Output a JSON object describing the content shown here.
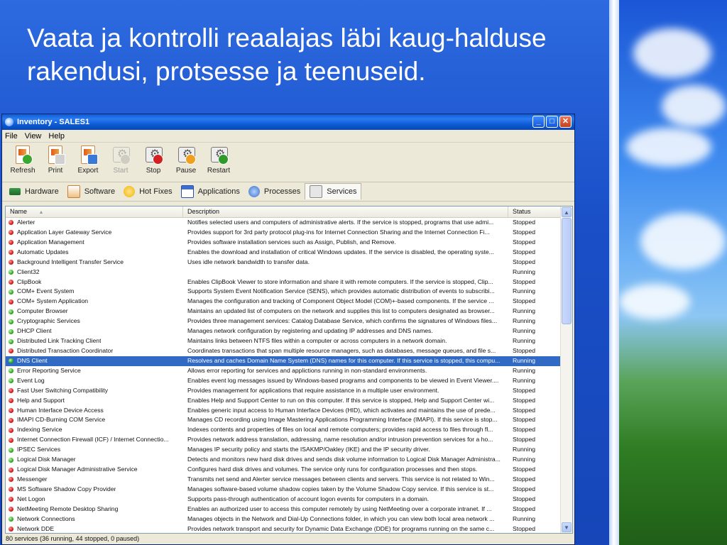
{
  "slide": {
    "title": "Vaata ja kontrolli reaalajas läbi kaug-halduse rakendusi, protsesse ja teenuseid."
  },
  "window": {
    "title": "Inventory - SALES1",
    "controls": {
      "minimize": "_",
      "maximize": "□",
      "close": "✕"
    }
  },
  "menu": {
    "file": "File",
    "view": "View",
    "help": "Help"
  },
  "toolbar": {
    "refresh": "Refresh",
    "print": "Print",
    "export": "Export",
    "start": "Start",
    "stop": "Stop",
    "pause": "Pause",
    "restart": "Restart"
  },
  "tabs": {
    "hardware": "Hardware",
    "software": "Software",
    "hotfixes": "Hot Fixes",
    "applications": "Applications",
    "processes": "Processes",
    "services": "Services"
  },
  "list": {
    "columns": {
      "name": "Name",
      "description": "Description",
      "status": "Status"
    },
    "sort_indicator": "▲",
    "rows": [
      {
        "name": "Alerter",
        "description": "Notifies selected users and computers of administrative alerts. If the service is stopped, programs that use admi...",
        "status": "Stopped",
        "icon": "stopped"
      },
      {
        "name": "Application Layer Gateway Service",
        "description": "Provides support for 3rd party protocol plug-ins for Internet Connection Sharing and the Internet Connection Fi...",
        "status": "Stopped",
        "icon": "stopped"
      },
      {
        "name": "Application Management",
        "description": "Provides software installation services such as Assign, Publish, and Remove.",
        "status": "Stopped",
        "icon": "stopped"
      },
      {
        "name": "Automatic Updates",
        "description": "Enables the download and installation of critical Windows updates. If the service is disabled, the operating syste...",
        "status": "Stopped",
        "icon": "stopped"
      },
      {
        "name": "Background Intelligent Transfer Service",
        "description": "Uses idle network bandwidth to transfer data.",
        "status": "Stopped",
        "icon": "stopped"
      },
      {
        "name": "Client32",
        "description": "",
        "status": "Running",
        "icon": "running"
      },
      {
        "name": "ClipBook",
        "description": "Enables ClipBook Viewer to store information and share it with remote computers. If the service is stopped, Clip...",
        "status": "Stopped",
        "icon": "stopped"
      },
      {
        "name": "COM+ Event System",
        "description": "Supports System Event Notification Service (SENS), which provides automatic distribution of events to subscribi...",
        "status": "Running",
        "icon": "running"
      },
      {
        "name": "COM+ System Application",
        "description": "Manages the configuration and tracking of Component Object Model (COM)+-based components. If the service ...",
        "status": "Stopped",
        "icon": "stopped"
      },
      {
        "name": "Computer Browser",
        "description": "Maintains an updated list of computers on the network and supplies this list to computers designated as browser...",
        "status": "Running",
        "icon": "running"
      },
      {
        "name": "Cryptographic Services",
        "description": "Provides three management services: Catalog Database Service, which confirms the signatures of Windows files...",
        "status": "Running",
        "icon": "running"
      },
      {
        "name": "DHCP Client",
        "description": "Manages network configuration by registering and updating IP addresses and DNS names.",
        "status": "Running",
        "icon": "running"
      },
      {
        "name": "Distributed Link Tracking Client",
        "description": "Maintains links between NTFS files within a computer or across computers in a network domain.",
        "status": "Running",
        "icon": "running"
      },
      {
        "name": "Distributed Transaction Coordinator",
        "description": "Coordinates transactions that span multiple resource managers, such as databases, message queues, and file s...",
        "status": "Stopped",
        "icon": "stopped"
      },
      {
        "name": "DNS Client",
        "description": "Resolves and caches Domain Name System (DNS) names for this computer. If this service is stopped, this compu...",
        "status": "Running",
        "icon": "running",
        "selected": true
      },
      {
        "name": "Error Reporting Service",
        "description": "Allows error reporting for services and applictions running in non-standard environments.",
        "status": "Running",
        "icon": "running"
      },
      {
        "name": "Event Log",
        "description": "Enables event log messages issued by Windows-based programs and components to be viewed in Event Viewer....",
        "status": "Running",
        "icon": "running"
      },
      {
        "name": "Fast User Switching Compatibility",
        "description": "Provides management for applications that require assistance in a multiple user environment.",
        "status": "Stopped",
        "icon": "stopped"
      },
      {
        "name": "Help and Support",
        "description": "Enables Help and Support Center to run on this computer. If this service is stopped, Help and Support Center wi...",
        "status": "Stopped",
        "icon": "stopped"
      },
      {
        "name": "Human Interface Device Access",
        "description": "Enables generic input access to Human Interface Devices (HID), which activates and maintains the use of prede...",
        "status": "Stopped",
        "icon": "stopped"
      },
      {
        "name": "IMAPI CD-Burning COM Service",
        "description": "Manages CD recording using Image Mastering Applications Programming Interface (IMAPI). If this service is stop...",
        "status": "Stopped",
        "icon": "stopped"
      },
      {
        "name": "Indexing Service",
        "description": "Indexes contents and properties of files on local and remote computers; provides rapid access to files through fl...",
        "status": "Stopped",
        "icon": "stopped"
      },
      {
        "name": "Internet Connection Firewall (ICF) / Internet Connectio...",
        "description": "Provides network address translation, addressing, name resolution and/or intrusion prevention services for a ho...",
        "status": "Stopped",
        "icon": "stopped"
      },
      {
        "name": "IPSEC Services",
        "description": "Manages IP security policy and starts the ISAKMP/Oakley (IKE) and the IP security driver.",
        "status": "Running",
        "icon": "running"
      },
      {
        "name": "Logical Disk Manager",
        "description": "Detects and monitors new hard disk drives and sends disk volume information to Logical Disk Manager Administra...",
        "status": "Running",
        "icon": "running"
      },
      {
        "name": "Logical Disk Manager Administrative Service",
        "description": "Configures hard disk drives and volumes. The service only runs for configuration processes and then stops.",
        "status": "Stopped",
        "icon": "stopped"
      },
      {
        "name": "Messenger",
        "description": "Transmits net send and Alerter service messages between clients and servers. This service is not related to Win...",
        "status": "Stopped",
        "icon": "stopped"
      },
      {
        "name": "MS Software Shadow Copy Provider",
        "description": "Manages software-based volume shadow copies taken by the Volume Shadow Copy service. If this service is st...",
        "status": "Stopped",
        "icon": "stopped"
      },
      {
        "name": "Net Logon",
        "description": "Supports pass-through authentication of account logon events for computers in a domain.",
        "status": "Stopped",
        "icon": "stopped"
      },
      {
        "name": "NetMeeting Remote Desktop Sharing",
        "description": "Enables an authorized user to access this computer remotely by using NetMeeting over a corporate intranet. If ...",
        "status": "Stopped",
        "icon": "stopped"
      },
      {
        "name": "Network Connections",
        "description": "Manages objects in the Network and Dial-Up Connections folder, in which you can view both local area network ...",
        "status": "Running",
        "icon": "running"
      },
      {
        "name": "Network DDE",
        "description": "Provides network transport and security for Dynamic Data Exchange (DDE) for programs running on the same c...",
        "status": "Stopped",
        "icon": "stopped"
      }
    ]
  },
  "scrollbar": {
    "up": "▲",
    "down": "▼"
  },
  "status_bar": "80 services (36 running, 44 stopped, 0 paused)"
}
